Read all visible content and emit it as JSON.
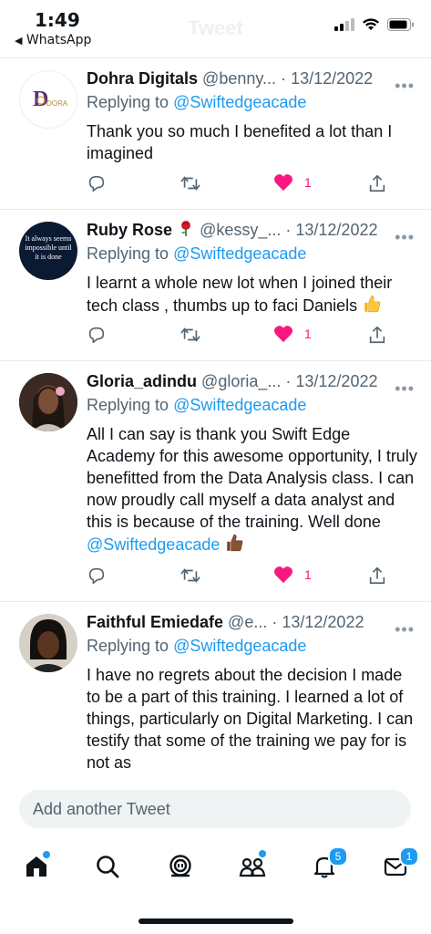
{
  "status_bar": {
    "time": "1:49",
    "back_app": "WhatsApp",
    "page_title": "Tweet"
  },
  "tweets": [
    {
      "name": "Dohra Digitals",
      "handle": "@benny...",
      "date": "13/12/2022",
      "replying_label": "Replying to",
      "replying_to": "@Swiftedgeacade",
      "text": "Thank you so much I benefited a lot than I imagined",
      "likes": "1",
      "avatar_logo_text": "DORA"
    },
    {
      "name": "Ruby Rose",
      "handle": "@kessy_...",
      "date": "13/12/2022",
      "replying_label": "Replying to",
      "replying_to": "@Swiftedgeacade",
      "text": "I learnt a whole new lot when I joined their tech class , thumbs up to faci Daniels",
      "likes": "1",
      "avatar_text": "It always seems impossible until it is done"
    },
    {
      "name": "Gloria_adindu",
      "handle": "@gloria_...",
      "date": "13/12/2022",
      "replying_label": "Replying to",
      "replying_to": "@Swiftedgeacade",
      "text": "All I can say is thank you Swift Edge Academy for this awesome opportunity, I truly benefitted from the Data Analysis class. I can now proudly call myself a data analyst and this is because of the training. Well done",
      "text_mention": "@Swiftedgeacade",
      "likes": "1"
    },
    {
      "name": "Faithful Emiedafe",
      "handle": "@e...",
      "date": "13/12/2022",
      "replying_label": "Replying to",
      "replying_to": "@Swiftedgeacade",
      "text": "I have no regrets about the decision I made to be a part of this training. I learned a lot of things, particularly on Digital Marketing. I can testify that some of the training we pay for is not as"
    }
  ],
  "composer": {
    "placeholder": "Add another Tweet"
  },
  "tabbar": {
    "notifications_badge": "5",
    "messages_badge": "1"
  },
  "colors": {
    "accent": "#1d9bf0",
    "like": "#f91880",
    "text": "#0f1419",
    "muted": "#536471"
  },
  "icons": [
    "reply-icon",
    "retweet-icon",
    "heart-icon",
    "share-icon",
    "more-icon",
    "home-icon",
    "search-icon",
    "spaces-icon",
    "communities-icon",
    "notifications-icon",
    "messages-icon"
  ]
}
